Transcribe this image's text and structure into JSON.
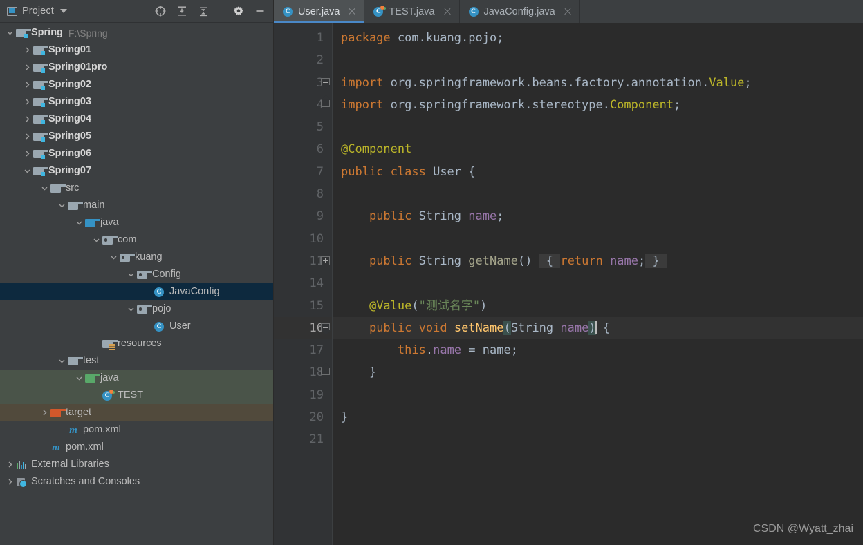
{
  "colors": {
    "panel_bg": "#3c3f41",
    "editor_bg": "#2b2b2b",
    "gutter_bg": "#313335",
    "selection": "#0d293e",
    "test_band": "#4a5449",
    "target_band": "#514a3c",
    "accent_blue": "#3592c4",
    "tab_active_underline": "#4a88c7",
    "keyword": "#cc7832",
    "string": "#6a8759",
    "annotation": "#bbb529",
    "field": "#9876aa",
    "text": "#a9b7c6"
  },
  "panel": {
    "title": "Project",
    "title_icon": "window-icon",
    "dropdown_icon": "chevron-down-icon",
    "actions": [
      {
        "name": "select-opened-file-icon",
        "label": "Select Opened File"
      },
      {
        "name": "expand-all-icon",
        "label": "Expand All"
      },
      {
        "name": "collapse-all-icon",
        "label": "Collapse All"
      },
      {
        "name": "settings-gear-icon",
        "label": "Settings"
      },
      {
        "name": "hide-icon",
        "label": "Hide"
      }
    ]
  },
  "tree": [
    {
      "label": "Spring",
      "sub": "F:\\Spring",
      "indent": 0,
      "arrow": "down",
      "icon": "module-folder",
      "bold": true,
      "state": "normal"
    },
    {
      "label": "Spring01",
      "sub": "",
      "indent": 1,
      "arrow": "right",
      "icon": "module-folder",
      "bold": true,
      "state": "normal"
    },
    {
      "label": "Spring01pro",
      "sub": "",
      "indent": 1,
      "arrow": "right",
      "icon": "module-folder",
      "bold": true,
      "state": "normal"
    },
    {
      "label": "Spring02",
      "sub": "",
      "indent": 1,
      "arrow": "right",
      "icon": "module-folder",
      "bold": true,
      "state": "normal"
    },
    {
      "label": "Spring03",
      "sub": "",
      "indent": 1,
      "arrow": "right",
      "icon": "module-folder",
      "bold": true,
      "state": "normal"
    },
    {
      "label": "Spring04",
      "sub": "",
      "indent": 1,
      "arrow": "right",
      "icon": "module-folder",
      "bold": true,
      "state": "normal"
    },
    {
      "label": "Spring05",
      "sub": "",
      "indent": 1,
      "arrow": "right",
      "icon": "module-folder",
      "bold": true,
      "state": "normal"
    },
    {
      "label": "Spring06",
      "sub": "",
      "indent": 1,
      "arrow": "right",
      "icon": "module-folder",
      "bold": true,
      "state": "normal"
    },
    {
      "label": "Spring07",
      "sub": "",
      "indent": 1,
      "arrow": "down",
      "icon": "module-folder",
      "bold": true,
      "state": "normal"
    },
    {
      "label": "src",
      "sub": "",
      "indent": 2,
      "arrow": "down",
      "icon": "folder-gray",
      "bold": false,
      "state": "normal"
    },
    {
      "label": "main",
      "sub": "",
      "indent": 3,
      "arrow": "down",
      "icon": "folder-gray",
      "bold": false,
      "state": "normal"
    },
    {
      "label": "java",
      "sub": "",
      "indent": 4,
      "arrow": "down",
      "icon": "folder-blue",
      "bold": false,
      "state": "normal"
    },
    {
      "label": "com",
      "sub": "",
      "indent": 5,
      "arrow": "down",
      "icon": "package",
      "bold": false,
      "state": "normal"
    },
    {
      "label": "kuang",
      "sub": "",
      "indent": 6,
      "arrow": "down",
      "icon": "package",
      "bold": false,
      "state": "normal"
    },
    {
      "label": "Config",
      "sub": "",
      "indent": 7,
      "arrow": "down",
      "icon": "package",
      "bold": false,
      "state": "normal"
    },
    {
      "label": "JavaConfig",
      "sub": "",
      "indent": 8,
      "arrow": "none",
      "icon": "java-class",
      "bold": false,
      "state": "selected"
    },
    {
      "label": "pojo",
      "sub": "",
      "indent": 7,
      "arrow": "down",
      "icon": "package",
      "bold": false,
      "state": "normal"
    },
    {
      "label": "User",
      "sub": "",
      "indent": 8,
      "arrow": "none",
      "icon": "java-class",
      "bold": false,
      "state": "normal"
    },
    {
      "label": "resources",
      "sub": "",
      "indent": 5,
      "arrow": "none",
      "icon": "folder-resources",
      "bold": false,
      "state": "normal"
    },
    {
      "label": "test",
      "sub": "",
      "indent": 3,
      "arrow": "down",
      "icon": "folder-gray",
      "bold": false,
      "state": "normal"
    },
    {
      "label": "java",
      "sub": "",
      "indent": 4,
      "arrow": "down",
      "icon": "folder-green",
      "bold": false,
      "state": "test-band"
    },
    {
      "label": "TEST",
      "sub": "",
      "indent": 5,
      "arrow": "none",
      "icon": "java-test-class",
      "bold": false,
      "state": "test-band"
    },
    {
      "label": "target",
      "sub": "",
      "indent": 2,
      "arrow": "right",
      "icon": "folder-orange",
      "bold": false,
      "state": "target-band"
    },
    {
      "label": "pom.xml",
      "sub": "",
      "indent": 3,
      "arrow": "none",
      "icon": "maven",
      "bold": false,
      "state": "normal"
    },
    {
      "label": "pom.xml",
      "sub": "",
      "indent": 2,
      "arrow": "none",
      "icon": "maven",
      "bold": false,
      "state": "normal"
    },
    {
      "label": "External Libraries",
      "sub": "",
      "indent": 0,
      "arrow": "right",
      "icon": "libraries",
      "bold": false,
      "state": "normal"
    },
    {
      "label": "Scratches and Consoles",
      "sub": "",
      "indent": 0,
      "arrow": "right",
      "icon": "scratches",
      "bold": false,
      "state": "normal"
    }
  ],
  "tabs": [
    {
      "label": "User.java",
      "icon": "java-class",
      "active": true
    },
    {
      "label": "TEST.java",
      "icon": "java-test-class",
      "active": false
    },
    {
      "label": "JavaConfig.java",
      "icon": "java-class",
      "active": false
    }
  ],
  "editor": {
    "file": "User.java",
    "line_numbers": [
      1,
      2,
      3,
      4,
      5,
      6,
      7,
      8,
      9,
      10,
      11,
      14,
      15,
      16,
      17,
      18,
      19,
      20,
      21
    ],
    "current_line": 16,
    "code_lines": [
      "package com.kuang.pojo;",
      "",
      "import org.springframework.beans.factory.annotation.Value;",
      "import org.springframework.stereotype.Component;",
      "",
      "@Component",
      "public class User {",
      "",
      "    public String name;",
      "",
      "    public String getName() { return name; }",
      "",
      "    @Value(\"测试名字\")",
      "    public void setName(String name) {",
      "        this.name = name;",
      "    }",
      "",
      "}",
      ""
    ],
    "annotation_value": "测试名字"
  },
  "watermark": "CSDN @Wyatt_zhai"
}
